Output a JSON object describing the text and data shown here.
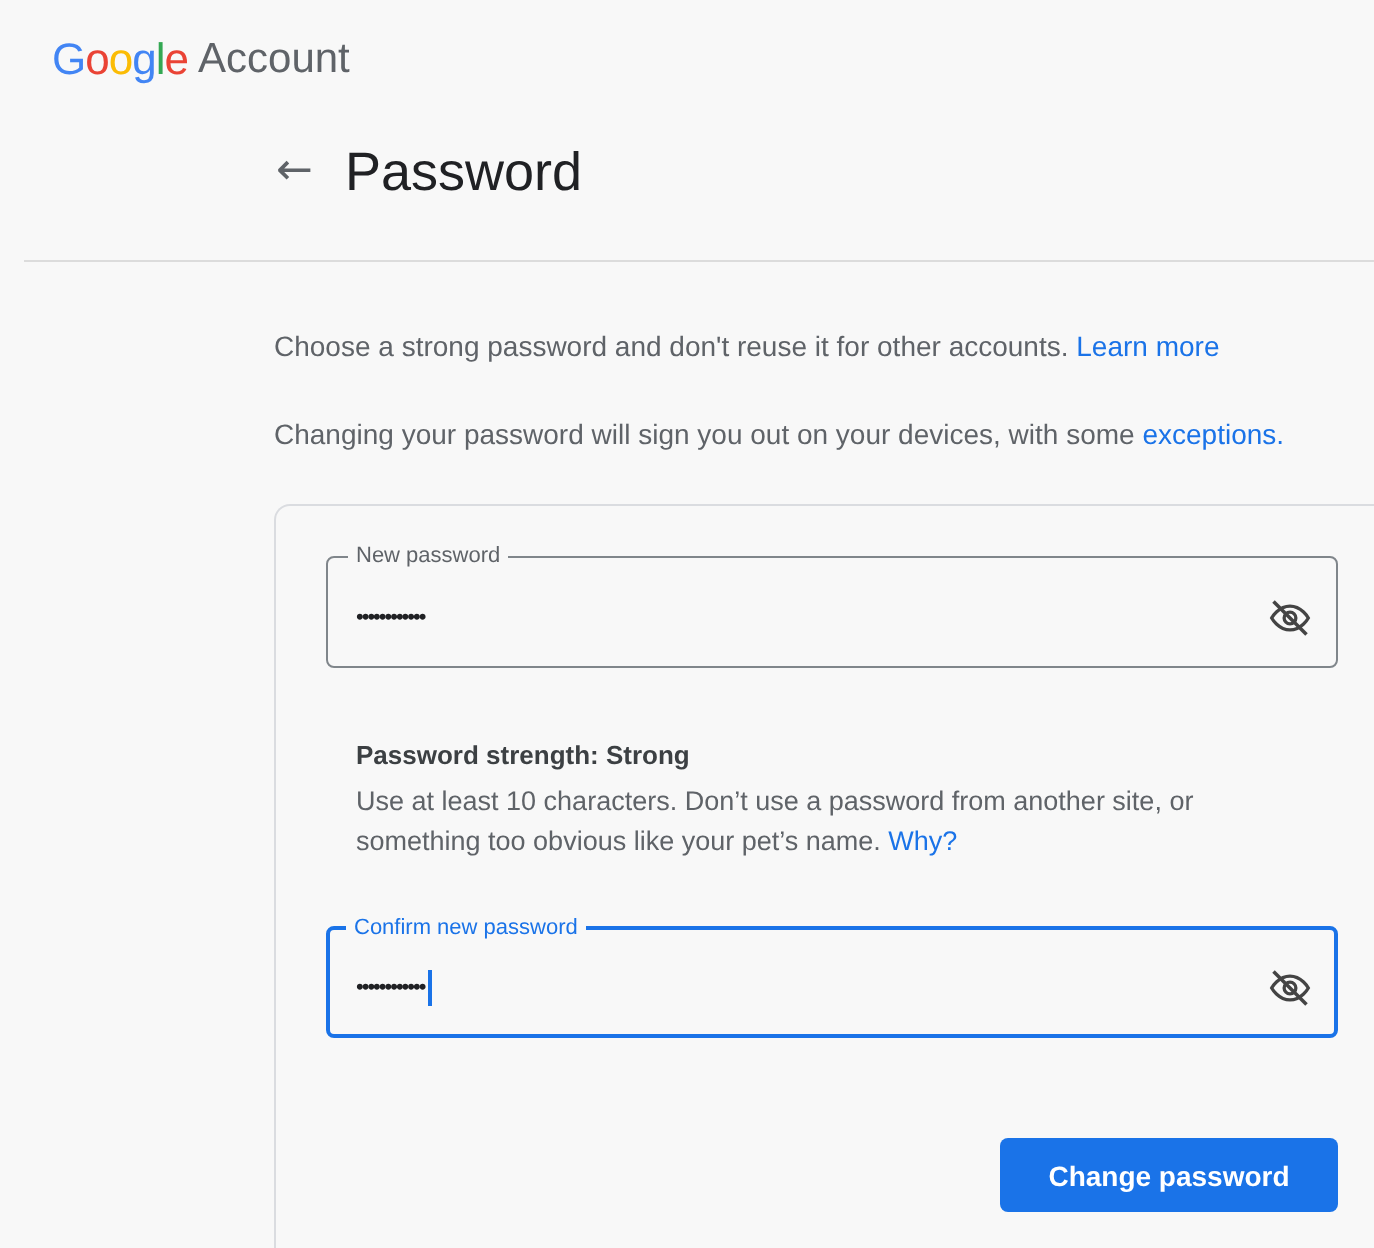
{
  "header": {
    "logo": "Google",
    "product": "Account"
  },
  "page": {
    "back": "←",
    "title": "Password"
  },
  "intro": [
    {
      "text": "Choose a strong password and don't reuse it for other accounts.",
      "link": "Learn more"
    },
    {
      "text": "Changing your password will sign you out on your devices, with some",
      "link": "exceptions."
    }
  ],
  "fields": [
    {
      "label": "New password",
      "value": "••••••••••••",
      "focused": false
    },
    {
      "kind": "hint",
      "title": "Password strength: Strong",
      "text": "Use at least 10 characters. Don’t use a password from another site, or something too obvious like your pet’s name.",
      "link": "Why?"
    },
    {
      "label": "Confirm new password",
      "value": "••••••••••••",
      "focused": true
    }
  ],
  "button": "Change password"
}
